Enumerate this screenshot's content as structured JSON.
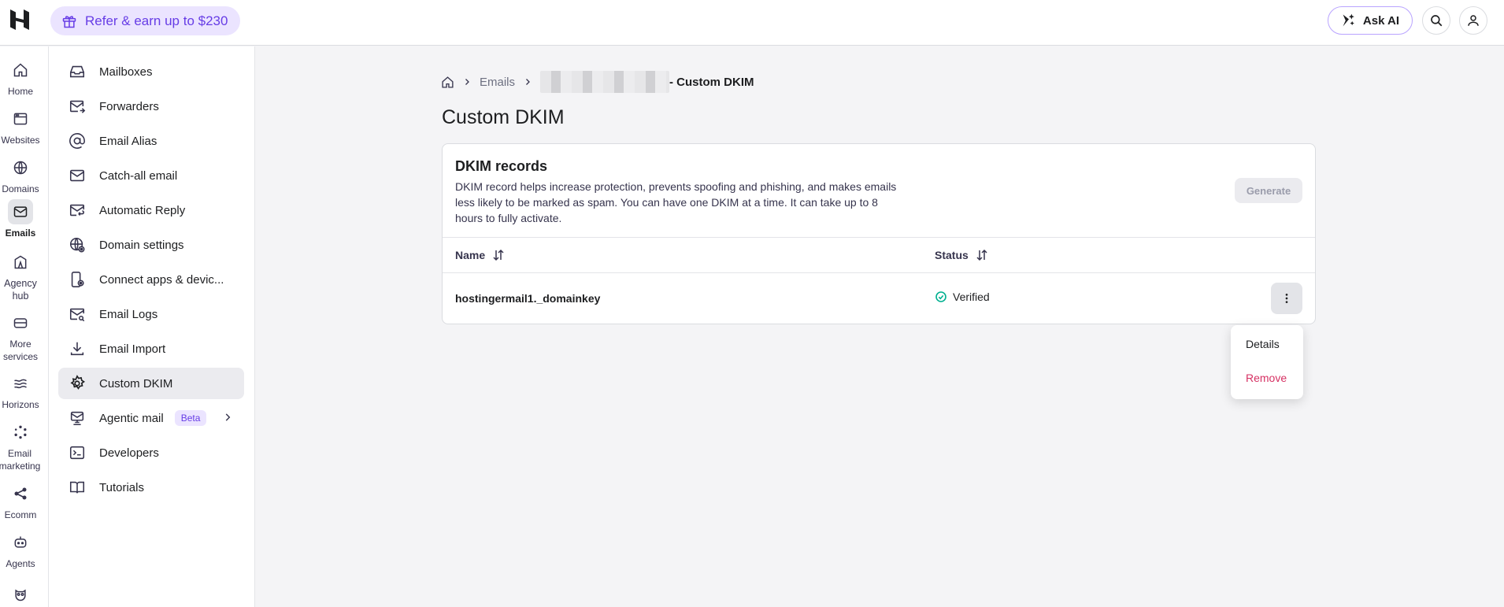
{
  "topbar": {
    "refer_label": "Refer & earn up to $230",
    "ask_ai_label": "Ask AI"
  },
  "rail": {
    "items": [
      {
        "label": "Home",
        "icon": "home-icon"
      },
      {
        "label": "Websites",
        "icon": "browser-icon"
      },
      {
        "label": "Domains",
        "icon": "globe-icon"
      },
      {
        "label": "Emails",
        "icon": "mail-icon",
        "active": true
      },
      {
        "label": "Agency hub",
        "icon": "agency-icon"
      },
      {
        "label": "More services",
        "icon": "box-icon"
      },
      {
        "label": "Horizons",
        "icon": "horizons-icon"
      },
      {
        "label": "Email marketing",
        "icon": "sparkle-icon"
      },
      {
        "label": "Ecomm",
        "icon": "share-nodes-icon"
      },
      {
        "label": "Agents",
        "icon": "robot-icon"
      }
    ]
  },
  "subnav": {
    "items": [
      {
        "label": "Mailboxes"
      },
      {
        "label": "Forwarders"
      },
      {
        "label": "Email Alias"
      },
      {
        "label": "Catch-all email"
      },
      {
        "label": "Automatic Reply"
      },
      {
        "label": "Domain settings"
      },
      {
        "label": "Connect apps & devic..."
      },
      {
        "label": "Email Logs"
      },
      {
        "label": "Email Import"
      },
      {
        "label": "Custom DKIM",
        "active": true
      },
      {
        "label": "Agentic mail",
        "badge": "Beta"
      },
      {
        "label": "Developers"
      },
      {
        "label": "Tutorials"
      }
    ]
  },
  "breadcrumb": {
    "emails": "Emails",
    "current": "- Custom DKIM"
  },
  "page": {
    "title": "Custom DKIM"
  },
  "card": {
    "title": "DKIM records",
    "description": "DKIM record helps increase protection, prevents spoofing and phishing, and makes emails less likely to be marked as spam. You can have one DKIM at a time. It can take up to 8 hours to fully activate.",
    "generate_label": "Generate",
    "columns": {
      "name": "Name",
      "status": "Status"
    },
    "rows": [
      {
        "name": "hostingermail1._domainkey",
        "status": "Verified"
      }
    ]
  },
  "menu": {
    "details": "Details",
    "remove": "Remove"
  },
  "colors": {
    "accent": "#673de6",
    "danger": "#d63163",
    "success": "#00b090"
  }
}
